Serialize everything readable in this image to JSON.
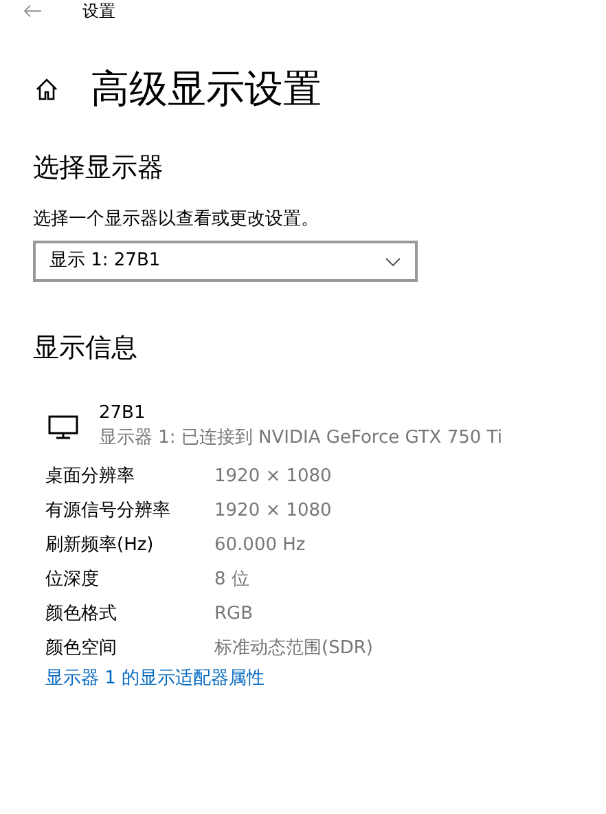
{
  "window": {
    "title": "设置"
  },
  "page_title": "高级显示设置",
  "select_section": {
    "heading": "选择显示器",
    "description": "选择一个显示器以查看或更改设置。",
    "dropdown": {
      "value": "显示 1: 27B1"
    }
  },
  "info_section": {
    "heading": "显示信息",
    "monitor": {
      "name": "27B1",
      "detail": "显示器 1: 已连接到 NVIDIA GeForce GTX 750 Ti"
    },
    "rows": [
      {
        "label": "桌面分辨率",
        "value": "1920 × 1080"
      },
      {
        "label": "有源信号分辨率",
        "value": "1920 × 1080"
      },
      {
        "label": "刷新频率(Hz)",
        "value": "60.000 Hz"
      },
      {
        "label": "位深度",
        "value": "8 位"
      },
      {
        "label": "颜色格式",
        "value": "RGB"
      },
      {
        "label": "颜色空间",
        "value": "标准动态范围(SDR)"
      }
    ],
    "link": "显示器 1 的显示适配器属性"
  }
}
